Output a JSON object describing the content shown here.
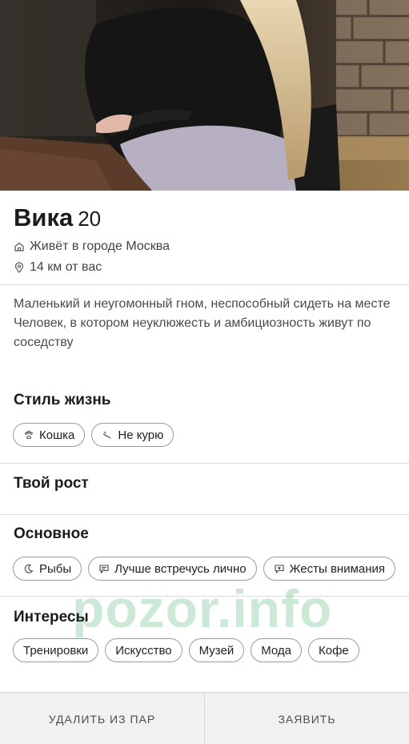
{
  "profile": {
    "name": "Вика",
    "age": "20",
    "city": "Живёт в городе Москва",
    "distance": "14 км от вас",
    "bio_line1": "Маленький и неугомонный гном, неспособный сидеть на месте",
    "bio_line2": "Человек, в котором неуклюжесть и амбициозность живут по соседству"
  },
  "lifestyle": {
    "title": "Стиль жизнь",
    "chips": [
      {
        "label": "Кошка",
        "icon": "paw-icon"
      },
      {
        "label": "Не курю",
        "icon": "no-smoking-icon"
      }
    ]
  },
  "height": {
    "title": "Твой рост"
  },
  "basics": {
    "title": "Основное",
    "chips": [
      {
        "label": "Рыбы",
        "icon": "moon-icon"
      },
      {
        "label": "Лучше встречусь лично",
        "icon": "chat-icon"
      },
      {
        "label": "Жесты внимания",
        "icon": "heart-chat-icon"
      }
    ]
  },
  "interests": {
    "title": "Интересы",
    "chips": [
      "Тренировки",
      "Искусство",
      "Музей",
      "Мода",
      "Кофе"
    ]
  },
  "watermark": "pozor.info",
  "actions": {
    "unmatch": "УДАЛИТЬ ИЗ ПАР",
    "report": "ЗАЯВИТЬ"
  },
  "colors": {
    "watermark": "#78c396",
    "bottom_bar": "#f1f1f1"
  }
}
